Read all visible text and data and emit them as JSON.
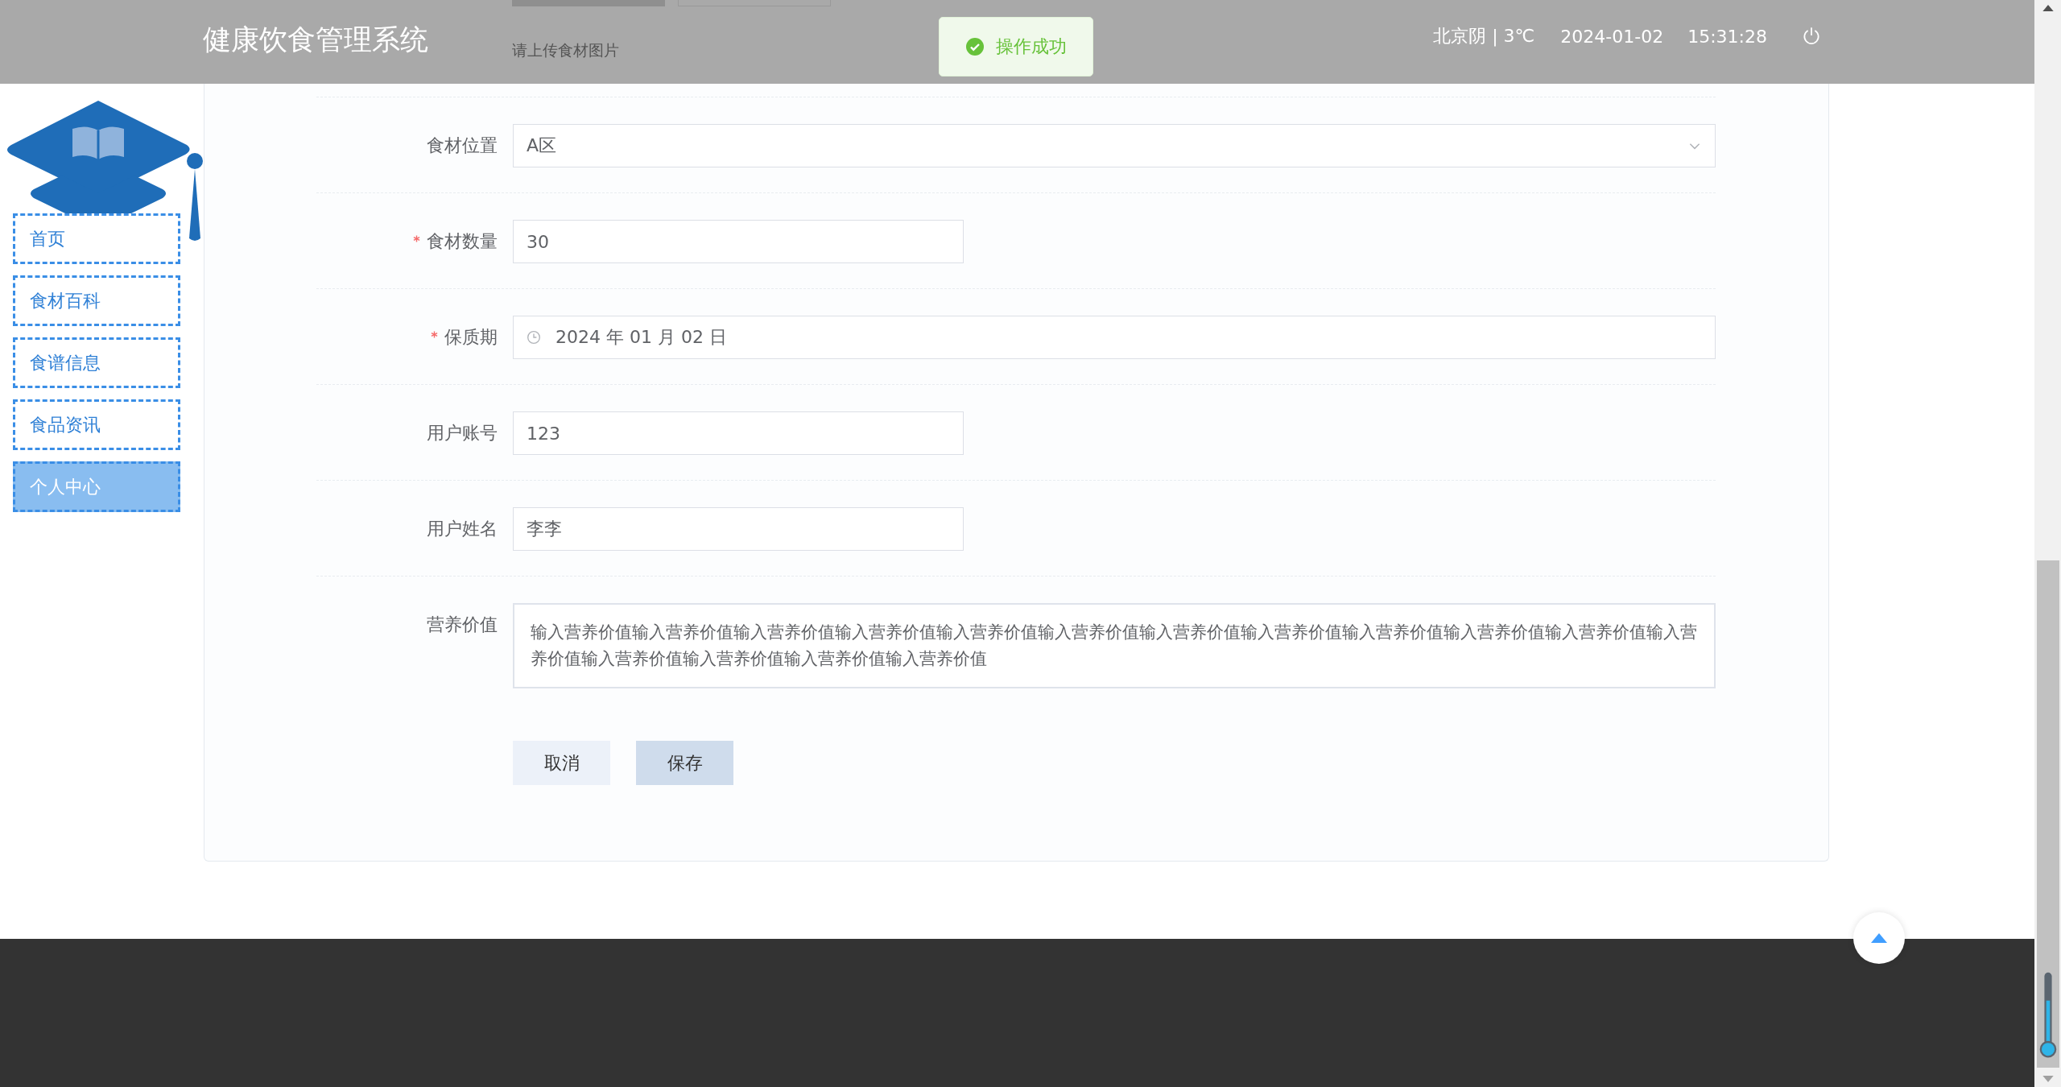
{
  "header": {
    "title": "健康饮食管理系统",
    "weather": "北京阴 | 3℃",
    "date": "2024-01-02",
    "time": "15:31:28"
  },
  "upload_hint": "请上传食材图片",
  "toast": {
    "message": "操作成功"
  },
  "sidebar": {
    "items": [
      {
        "label": "首页",
        "selected": false
      },
      {
        "label": "食材百科",
        "selected": false
      },
      {
        "label": "食谱信息",
        "selected": false
      },
      {
        "label": "食品资讯",
        "selected": false
      },
      {
        "label": "个人中心",
        "selected": true
      }
    ]
  },
  "form": {
    "fields": [
      {
        "kind": "select",
        "label": "食材位置",
        "required": false,
        "value": "A区"
      },
      {
        "kind": "text",
        "label": "食材数量",
        "required": true,
        "value": "30"
      },
      {
        "kind": "date",
        "label": "保质期",
        "required": true,
        "value": "2024 年 01 月 02 日"
      },
      {
        "kind": "text",
        "label": "用户账号",
        "required": false,
        "value": "123"
      },
      {
        "kind": "text",
        "label": "用户姓名",
        "required": false,
        "value": "李李"
      },
      {
        "kind": "textarea",
        "label": "营养价值",
        "required": false,
        "value": "输入营养价值输入营养价值输入营养价值输入营养价值输入营养价值输入营养价值输入营养价值输入营养价值输入营养价值输入营养价值输入营养价值输入营养价值输入营养价值输入营养价值输入营养价值输入营养价值"
      }
    ],
    "buttons": [
      {
        "label": "取消",
        "kind": "cancel"
      },
      {
        "label": "保存",
        "kind": "save"
      }
    ]
  }
}
